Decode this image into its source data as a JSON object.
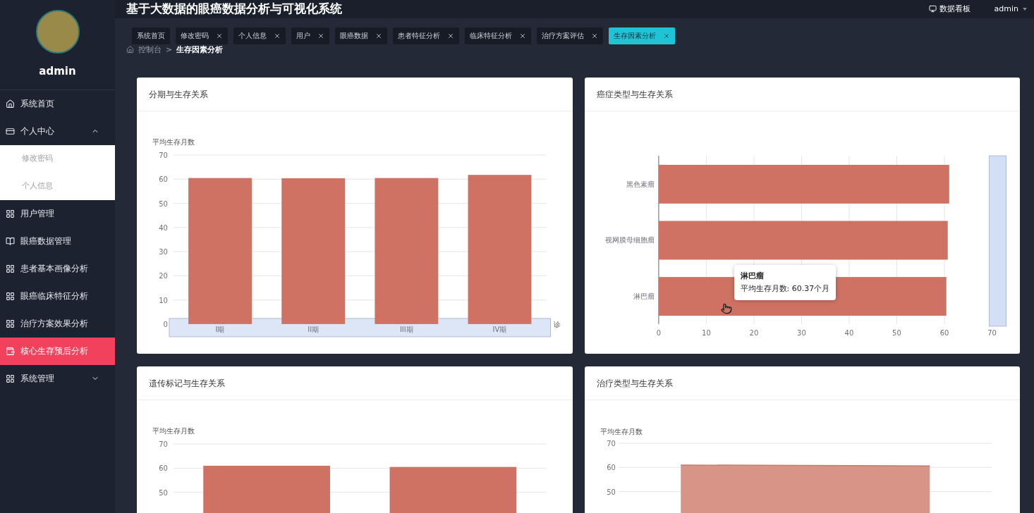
{
  "sidebar": {
    "user": "admin",
    "menu": [
      {
        "kind": "item",
        "label": "系统首页",
        "selected": false
      },
      {
        "kind": "group",
        "label": "个人中心",
        "selected": false,
        "expanded": true,
        "children": [
          {
            "label": "修改密码",
            "selected": false
          },
          {
            "label": "个人信息",
            "selected": false
          }
        ]
      },
      {
        "kind": "item",
        "label": "用户管理",
        "selected": false
      },
      {
        "kind": "item",
        "label": "眼癌数据管理",
        "selected": false
      },
      {
        "kind": "item",
        "label": "患者基本画像分析",
        "selected": false
      },
      {
        "kind": "item",
        "label": "眼癌临床特征分析",
        "selected": false
      },
      {
        "kind": "item",
        "label": "治疗方案效果分析",
        "selected": false
      },
      {
        "kind": "item",
        "label": "核心生存预后分析",
        "selected": true
      },
      {
        "kind": "group",
        "label": "系统管理",
        "selected": false,
        "expanded": false
      }
    ]
  },
  "header": {
    "title": "基于大数据的眼癌数据分析与可视化系统",
    "dashboard_link": "数据看板",
    "user": "admin"
  },
  "tabs": [
    {
      "label": "系统首页",
      "closable": false,
      "selected": false
    },
    {
      "label": "修改密码",
      "closable": true,
      "selected": false
    },
    {
      "label": "个人信息",
      "closable": true,
      "selected": false
    },
    {
      "label": "用户",
      "closable": true,
      "selected": false
    },
    {
      "label": "眼癌数据",
      "closable": true,
      "selected": false
    },
    {
      "label": "患者特征分析",
      "closable": true,
      "selected": false
    },
    {
      "label": "临床特征分析",
      "closable": true,
      "selected": false
    },
    {
      "label": "治疗方案评估",
      "closable": true,
      "selected": false
    },
    {
      "label": "生存因素分析",
      "closable": true,
      "selected": true
    }
  ],
  "breadcrumb": [
    "控制台",
    ">",
    "生存因素分析"
  ],
  "cards": [
    {
      "title": "分期与生存关系",
      "chart_data": {
        "type": "bar",
        "orientation": "vertical",
        "ylabel": "平均生存月数",
        "xlabel": "诊",
        "grid": true,
        "categories": [
          "I期",
          "II期",
          "III期",
          "IV期"
        ],
        "series": [
          {
            "color": "#cf7264",
            "values": [
              60.5,
              60.4,
              60.5,
              61.8
            ]
          }
        ],
        "ylim": [
          0,
          70
        ],
        "yticks": [
          0,
          10,
          20,
          30,
          40,
          50,
          60,
          70
        ]
      }
    },
    {
      "title": "癌症类型与生存关系",
      "chart_data": {
        "type": "bar",
        "orientation": "horizontal",
        "grid": true,
        "categories": [
          "黑色素瘤",
          "视网膜母细胞瘤",
          "淋巴瘤"
        ],
        "series": [
          {
            "color": "#cf7264",
            "values": [
              61.0,
              60.7,
              60.4
            ]
          }
        ],
        "xlim": [
          0,
          70
        ],
        "xticks": [
          0,
          10,
          20,
          30,
          40,
          50,
          60,
          70
        ]
      },
      "tooltip": {
        "title": "淋巴瘤",
        "text": "平均生存月数: 60.37个月"
      }
    },
    {
      "title": "遗传标记与生存关系",
      "chart_data": {
        "type": "bar",
        "orientation": "vertical",
        "ylabel": "平均生存月数",
        "grid": true,
        "series": [
          {
            "color": "#cf7264",
            "values": [
              61.0,
              60.5
            ]
          }
        ],
        "ylim": [
          0,
          70
        ],
        "yticks": [
          50,
          60,
          70
        ]
      }
    },
    {
      "title": "治疗类型与生存关系",
      "chart_data": {
        "type": "area",
        "ylabel": "平均生存月数",
        "grid": true,
        "series": [
          {
            "color": "#d99488",
            "values": [
              61.0,
              60.8,
              60.6
            ]
          }
        ],
        "ylim": [
          0,
          70
        ],
        "yticks": [
          50,
          60,
          70
        ]
      }
    }
  ]
}
